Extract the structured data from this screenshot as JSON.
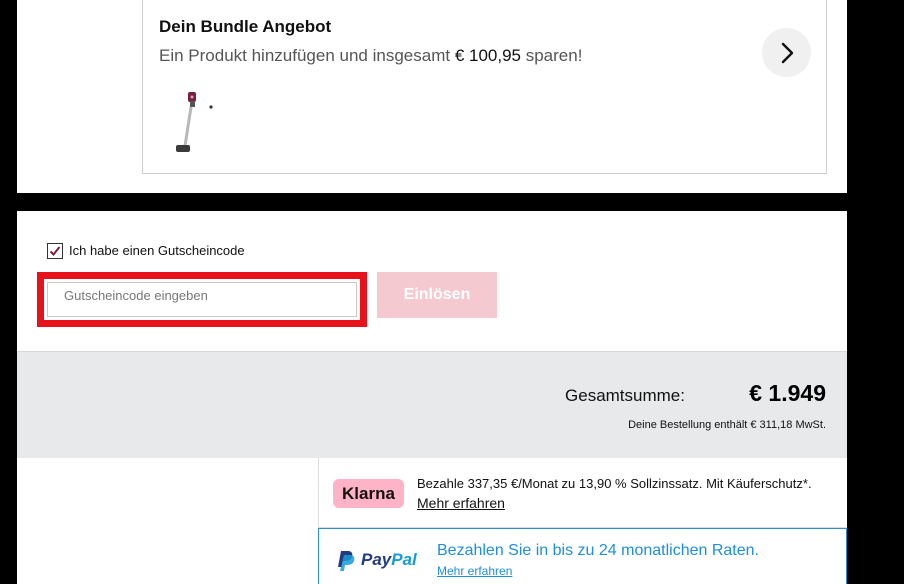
{
  "bundle": {
    "title": "Dein Bundle Angebot",
    "subtitle_before": "Ein Produkt hinzufügen und insgesamt ",
    "savings": "€ 100,95",
    "subtitle_after": " sparen!",
    "next_icon": "chevron-right-icon",
    "product_icon": "stick-vacuum-image"
  },
  "coupon": {
    "checkbox_checked": true,
    "checkbox_label": "Ich habe einen Gutscheincode",
    "input_placeholder": "Gutscheincode eingeben",
    "input_value": "",
    "redeem_label": "Einlösen",
    "highlight_color": "#e8121c",
    "redeem_color": "#f4c9d0"
  },
  "total": {
    "label": "Gesamtsumme:",
    "value": "€ 1.949",
    "vat_note": "Deine Bestellung enthält € 311,18 MwSt."
  },
  "payment": {
    "klarna": {
      "logo": "Klarna",
      "text": "Bezahle 337,35 €/Monat zu 13,90 % Sollzinssatz. Mit Käuferschutz*.",
      "link": "Mehr erfahren",
      "logo_color": "#ffb3c7"
    },
    "paypal": {
      "logo_pay": "Pay",
      "logo_pal": "Pal",
      "text": "Bezahlen Sie in bis zu 24 monatlichen Raten.",
      "link": "Mehr erfahren",
      "accent_color": "#1f8fd6"
    }
  }
}
